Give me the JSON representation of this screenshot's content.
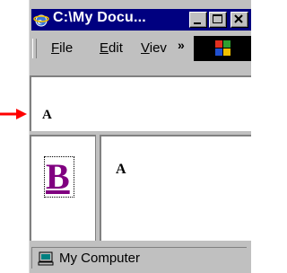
{
  "window": {
    "title": "C:\\My Docu..."
  },
  "menu": {
    "file": {
      "first": "F",
      "rest": "ile"
    },
    "edit": {
      "first": "E",
      "rest": "dit"
    },
    "view": {
      "first": "V",
      "rest": "iev"
    },
    "chevron": "»"
  },
  "frames": {
    "top_text": "A",
    "left_link": "B",
    "main_text": "A"
  },
  "status": {
    "zone": "My Computer"
  },
  "colors": {
    "titlebar": "#000080",
    "link": "#800080",
    "arrow": "#ff0000",
    "face": "#c0c0c0"
  },
  "icons": [
    "ie-logo-icon",
    "minimize-icon",
    "maximize-icon",
    "close-icon",
    "windows-logo-icon",
    "scroll-up-icon",
    "scroll-down-icon",
    "computer-icon",
    "arrow-icon"
  ]
}
